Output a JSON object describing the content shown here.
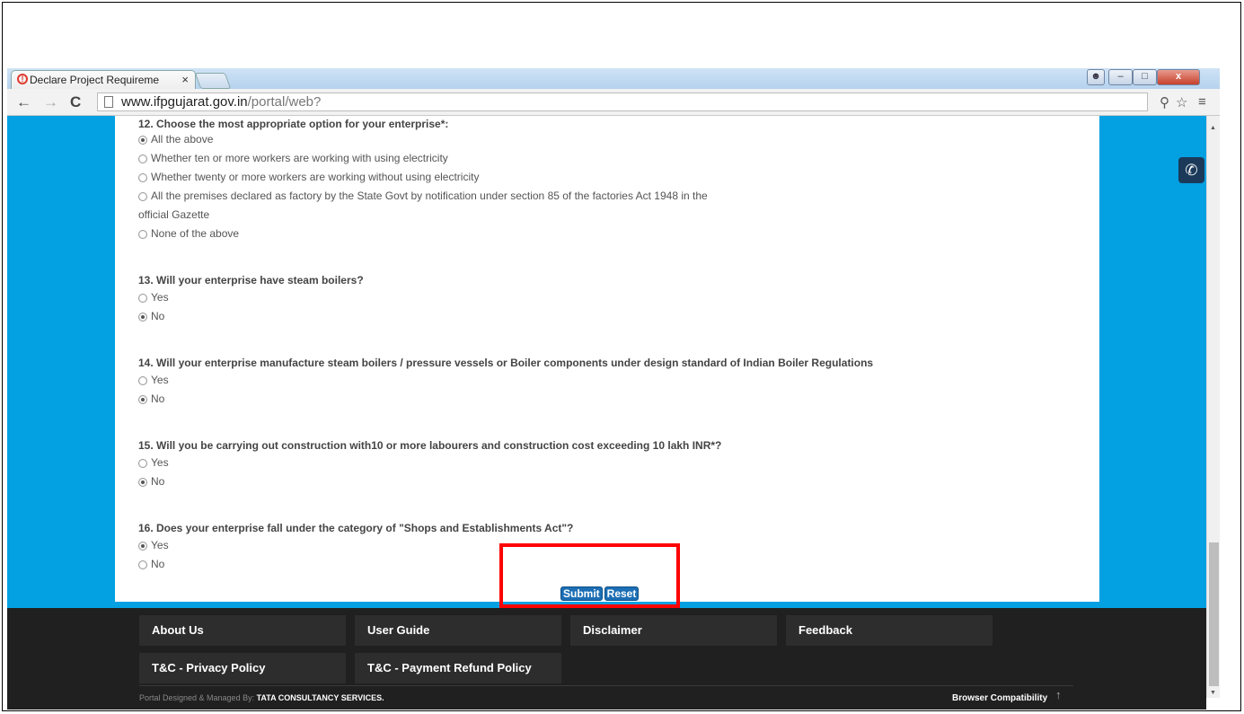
{
  "browser": {
    "tab_title": "Declare Project Requireme",
    "tab_close": "×",
    "url_host": "www.ifpgujarat.gov.in",
    "url_path": "/portal/web?"
  },
  "form": {
    "q12": {
      "title": "12. Choose the most appropriate option for your enterprise*:",
      "options": [
        "All the above",
        "Whether ten or more workers are working with using electricity",
        "Whether twenty or more workers are working without using electricity",
        "All the premises declared as factory by the State Govt by notification under section 85 of the factories Act 1948 in the",
        "official Gazette",
        "None of the above"
      ]
    },
    "q13": {
      "title": "13. Will your enterprise have steam boilers?",
      "yes": "Yes",
      "no": "No"
    },
    "q14": {
      "title": "14. Will your enterprise manufacture steam boilers / pressure vessels or Boiler components under design standard of Indian Boiler Regulations",
      "yes": "Yes",
      "no": "No"
    },
    "q15": {
      "title": "15. Will you be carrying out construction with10 or more labourers and construction cost exceeding 10 lakh INR*?",
      "yes": "Yes",
      "no": "No"
    },
    "q16": {
      "title": "16. Does your enterprise fall under the category of \"Shops and Establishments Act\"?",
      "yes": "Yes",
      "no": "No"
    },
    "submit_label": "Submit",
    "reset_label": "Reset"
  },
  "footer": {
    "links": [
      "About Us",
      "User Guide",
      "Disclaimer",
      "Feedback",
      "T&C - Privacy Policy",
      "T&C - Payment Refund Policy"
    ],
    "credit_prefix": "Portal Designed & Managed By:",
    "credit_company": "TATA CONSULTANCY SERVICES.",
    "compat": "Browser Compatibility"
  },
  "icons": {
    "phone": "phone-icon",
    "back": "back-arrow-icon",
    "forward": "forward-arrow-icon",
    "reload": "reload-icon"
  },
  "colors": {
    "page_background": "#03a0e2",
    "footer": "#202020",
    "button": "#1c6fb5",
    "highlight": "#ff0000"
  }
}
